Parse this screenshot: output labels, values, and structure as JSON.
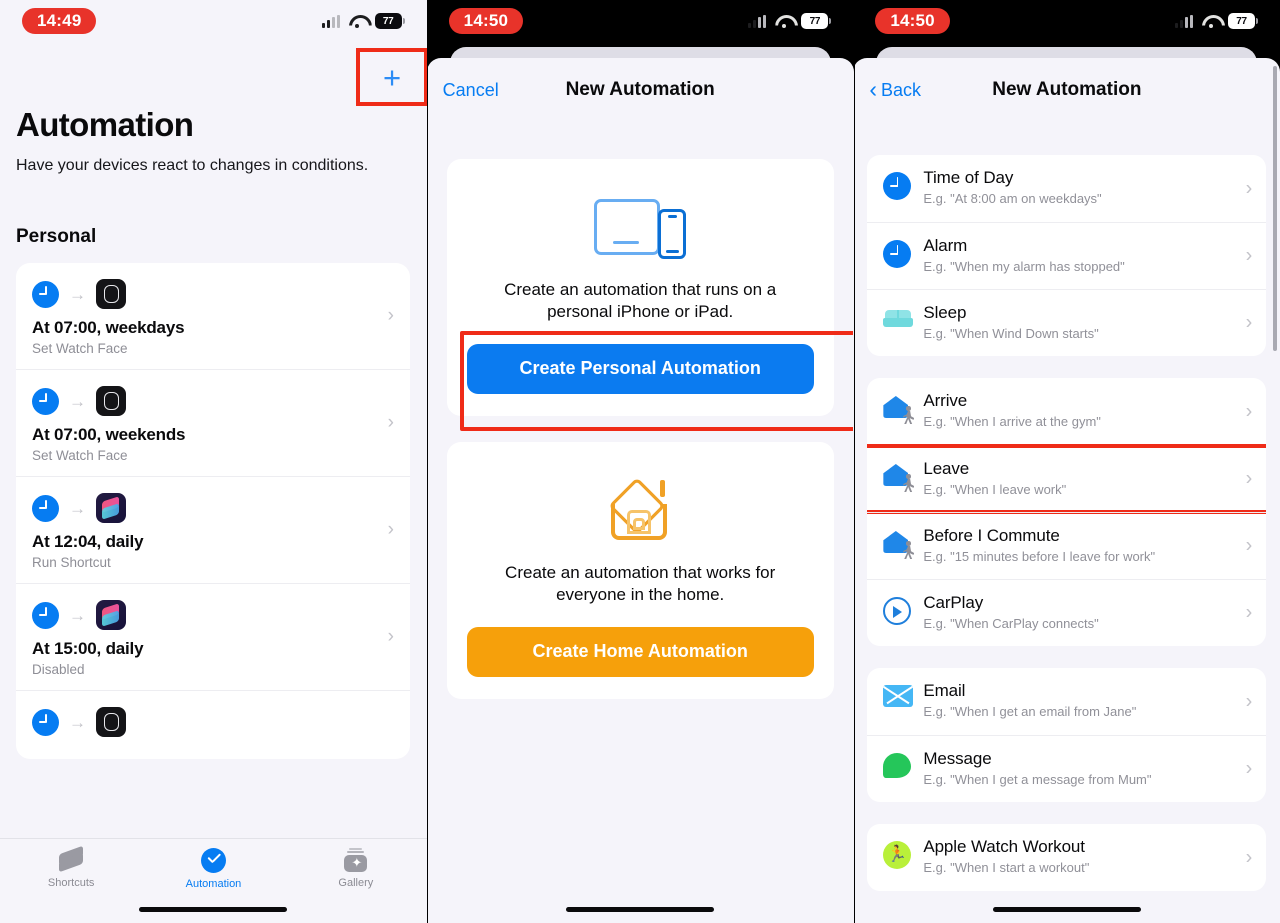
{
  "left_panel": {
    "status": {
      "time": "14:49",
      "battery": "77",
      "signal_icon": "cellular-bars-icon",
      "wifi_icon": "wifi-icon",
      "battery_icon": "battery-icon"
    },
    "add_button": {
      "label": "+",
      "name": "add-automation-button",
      "highlighted": true
    },
    "title": "Automation",
    "subtitle": "Have your devices react to changes in conditions.",
    "section_title": "Personal",
    "automations": [
      {
        "trigger_icon": "clock-icon",
        "app_icon": "apple-watch-icon",
        "name": "At 07:00, weekdays",
        "action": "Set Watch Face"
      },
      {
        "trigger_icon": "clock-icon",
        "app_icon": "apple-watch-icon",
        "name": "At 07:00, weekends",
        "action": "Set Watch Face"
      },
      {
        "trigger_icon": "clock-icon",
        "app_icon": "shortcuts-icon",
        "name": "At 12:04, daily",
        "action": "Run Shortcut"
      },
      {
        "trigger_icon": "clock-icon",
        "app_icon": "shortcuts-icon",
        "name": "At 15:00, daily",
        "action": "Disabled"
      },
      {
        "trigger_icon": "clock-icon",
        "app_icon": "apple-watch-icon",
        "name": "",
        "action": ""
      }
    ],
    "tabs": [
      {
        "label": "Shortcuts",
        "icon": "shortcuts-stack-icon",
        "active": false
      },
      {
        "label": "Automation",
        "icon": "automation-check-icon",
        "active": true
      },
      {
        "label": "Gallery",
        "icon": "gallery-icon",
        "active": false
      }
    ]
  },
  "middle_panel": {
    "status": {
      "time": "14:50",
      "battery": "77"
    },
    "nav": {
      "left_label": "Cancel",
      "title": "New Automation"
    },
    "cards": [
      {
        "art": "ipad-iphone-icon",
        "description": "Create an automation that runs on a personal iPhone or iPad.",
        "button_label": "Create Personal Automation",
        "button_color": "#0b7bf0",
        "highlighted": true
      },
      {
        "art": "home-house-icon",
        "description": "Create an automation that works for everyone in the home.",
        "button_label": "Create Home Automation",
        "button_color": "#f6a00b",
        "highlighted": false
      }
    ]
  },
  "right_panel": {
    "status": {
      "time": "14:50",
      "battery": "77"
    },
    "nav": {
      "left_label": "Back",
      "back_icon": "chevron-left-icon",
      "title": "New Automation"
    },
    "groups": [
      {
        "rows": [
          {
            "icon": "clock-icon",
            "title": "Time of Day",
            "example": "E.g. \"At 8:00 am on weekdays\""
          },
          {
            "icon": "clock-icon",
            "title": "Alarm",
            "example": "E.g. \"When my alarm has stopped\""
          },
          {
            "icon": "bed-icon",
            "title": "Sleep",
            "example": "E.g. \"When Wind Down starts\""
          }
        ]
      },
      {
        "rows": [
          {
            "icon": "home-walk-icon",
            "title": "Arrive",
            "example": "E.g. \"When I arrive at the gym\""
          },
          {
            "icon": "home-walk-icon",
            "title": "Leave",
            "example": "E.g. \"When I leave work\"",
            "highlighted": true
          },
          {
            "icon": "home-walk-icon",
            "title": "Before I Commute",
            "example": "E.g. \"15 minutes before I leave for work\""
          },
          {
            "icon": "carplay-icon",
            "title": "CarPlay",
            "example": "E.g. \"When CarPlay connects\""
          }
        ]
      },
      {
        "rows": [
          {
            "icon": "mail-icon",
            "title": "Email",
            "example": "E.g. \"When I get an email from Jane\""
          },
          {
            "icon": "message-icon",
            "title": "Message",
            "example": "E.g. \"When I get a message from Mum\""
          }
        ]
      },
      {
        "rows": [
          {
            "icon": "workout-icon",
            "title": "Apple Watch Workout",
            "example": "E.g. \"When I start a workout\""
          }
        ]
      }
    ]
  },
  "colors": {
    "accent_blue": "#067cf2",
    "orange": "#f6a00b",
    "highlight_red": "#ef2b18",
    "status_red": "#e8332a"
  }
}
